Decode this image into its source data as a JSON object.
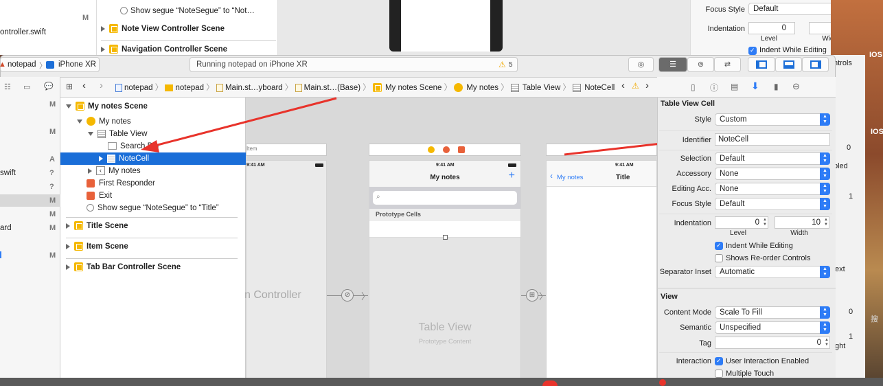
{
  "bg_window": {
    "items": [
      {
        "text": "Show segue “NoteSegue” to “Not…"
      },
      {
        "text": "Note View Controller Scene"
      },
      {
        "text": "Navigation Controller Scene"
      }
    ],
    "file_label": "ontroller.swift",
    "m": "M",
    "focus_style_label": "Focus Style",
    "focus_style_value": "Default",
    "indentation_label": "Indentation",
    "level_value": "0",
    "width_value": "10",
    "level_label": "Level",
    "width_label": "Width",
    "indent_while_editing": "Indent While Editing"
  },
  "toolbar": {
    "scheme": "notepad",
    "device": "iPhone XR",
    "activity": "Running notepad on iPhone XR",
    "warning_count": "5"
  },
  "breadcrumb": [
    "notepad",
    "notepad",
    "Main.st…yboard",
    "Main.st…(Base)",
    "My notes Scene",
    "My notes",
    "Table View",
    "NoteCell"
  ],
  "navigator": {
    "files": [
      {
        "name": "swift",
        "status": "?"
      },
      {
        "name": "ard",
        "status": "M"
      }
    ],
    "status_flags": [
      "M",
      "M",
      "A",
      "?",
      "?",
      "M",
      "M",
      "M",
      "M"
    ]
  },
  "outline": {
    "my_notes_scene": "My notes Scene",
    "my_notes": "My notes",
    "table_view": "Table View",
    "search_bar": "Search Bar",
    "note_cell": "NoteCell",
    "my_notes_item": "My notes",
    "first_responder": "First Responder",
    "exit": "Exit",
    "segue": "Show segue “NoteSegue” to “Title”",
    "title_scene": "Title Scene",
    "item_scene": "Item Scene",
    "tab_bar_scene": "Tab Bar Controller Scene"
  },
  "canvas": {
    "nav_controller_label": "n Controller",
    "item_label": "Item",
    "time": "9:41 AM",
    "phone2_title": "My notes",
    "add_glyph": "+",
    "search_glyph": "⌕",
    "prototype_cells": "Prototype Cells",
    "table_view_label": "Table View",
    "prototype_content": "Prototype Content",
    "back_label": "My notes",
    "phone3_title": "Title"
  },
  "inspector": {
    "section_cell": "Table View Cell",
    "style_label": "Style",
    "style_value": "Custom",
    "identifier_label": "Identifier",
    "identifier_value": "NoteCell",
    "selection_label": "Selection",
    "selection_value": "Default",
    "accessory_label": "Accessory",
    "accessory_value": "None",
    "editing_acc_label": "Editing Acc.",
    "editing_acc_value": "None",
    "focus_style_label": "Focus Style",
    "focus_style_value": "Default",
    "indentation_label": "Indentation",
    "level_value": "0",
    "width_value": "10",
    "level_label": "Level",
    "width_label": "Width",
    "indent_while_editing": "Indent While Editing",
    "shows_reorder": "Shows Re-order Controls",
    "separator_inset_label": "Separator Inset",
    "separator_inset_value": "Automatic",
    "section_view": "View",
    "content_mode_label": "Content Mode",
    "content_mode_value": "Scale To Fill",
    "semantic_label": "Semantic",
    "semantic_value": "Unspecified",
    "tag_label": "Tag",
    "tag_value": "0",
    "interaction_label": "Interaction",
    "user_interaction": "User Interaction Enabled",
    "multiple_touch": "Multiple Touch"
  },
  "right_strip": {
    "texts": [
      "ntrols",
      "IOS",
      "IOS",
      "0",
      "bled",
      "1",
      "ext",
      "0",
      "1",
      "ght",
      "搜"
    ]
  },
  "colors": {
    "accent": "#2e7cf6",
    "scene_yellow": "#f5b800",
    "arrow_red": "#e8332b",
    "selection_blue": "#1a6ed8"
  }
}
